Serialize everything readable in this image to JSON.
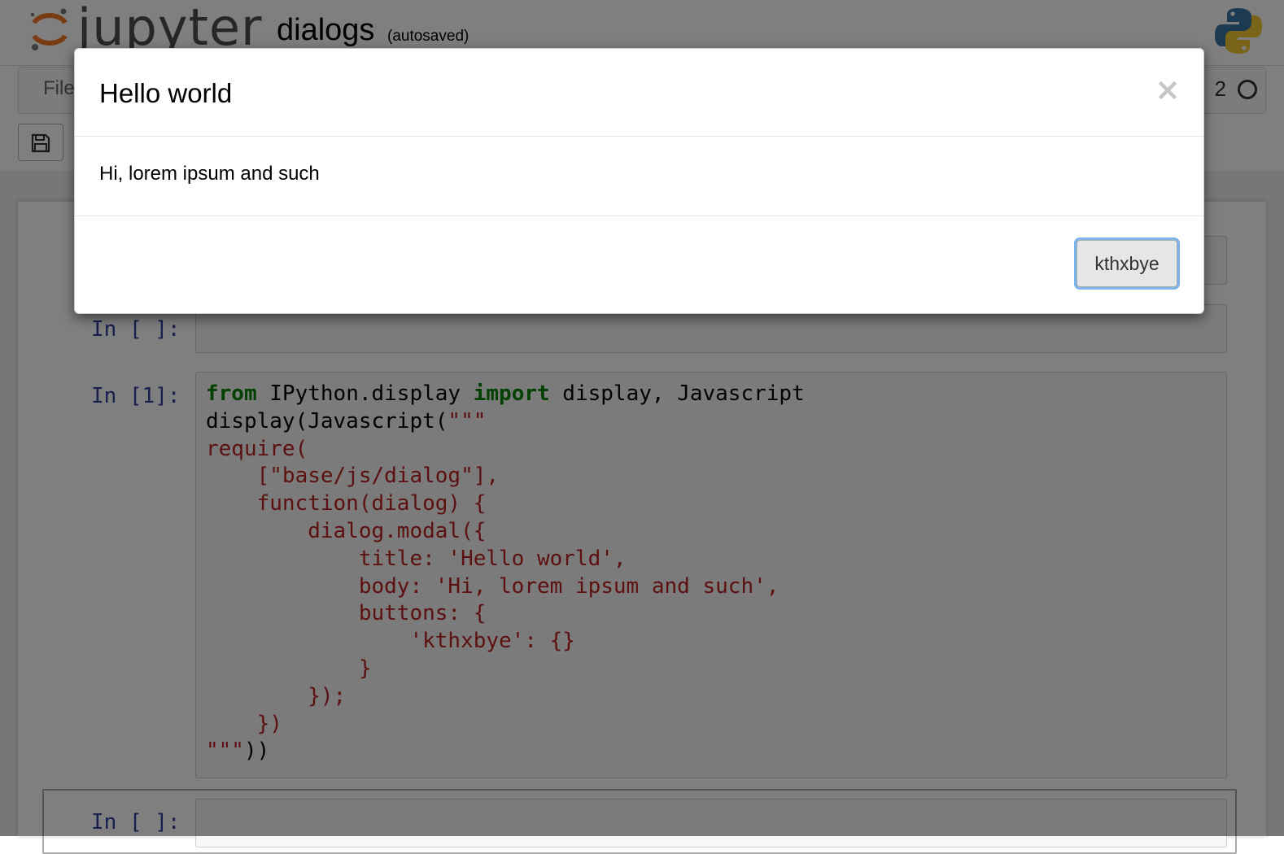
{
  "header": {
    "logo_text": "jupyter",
    "notebook_name": "dialogs",
    "autosave_status": "(autosaved)"
  },
  "menubar": {
    "file_label": "File",
    "kernel_fragment": "2"
  },
  "cells": [
    {
      "prompt": "In [ ]:"
    },
    {
      "prompt": "In [1]:"
    },
    {
      "prompt": "In [ ]:"
    }
  ],
  "code_lines": [
    "from IPython.display import display, Javascript",
    "display(Javascript(\"\"\"",
    "require(",
    "    [\"base/js/dialog\"],",
    "    function(dialog) {",
    "        dialog.modal({",
    "            title: 'Hello world',",
    "            body: 'Hi, lorem ipsum and such',",
    "            buttons: {",
    "                'kthxbye': {}",
    "            }",
    "        });",
    "    })",
    "\"\"\"))"
  ],
  "modal": {
    "title": "Hello world",
    "close_symbol": "×",
    "body": "Hi, lorem ipsum and such",
    "button_label": "kthxbye"
  },
  "colors": {
    "keyword": "#008000",
    "string": "#ba2121",
    "prompt": "#303f9f",
    "logo_orange": "#f37726",
    "focus_ring": "#7db3ec"
  },
  "icons": [
    "jupyter-logo-icon",
    "python-logo-icon",
    "save-icon",
    "close-icon",
    "kernel-idle-icon"
  ]
}
